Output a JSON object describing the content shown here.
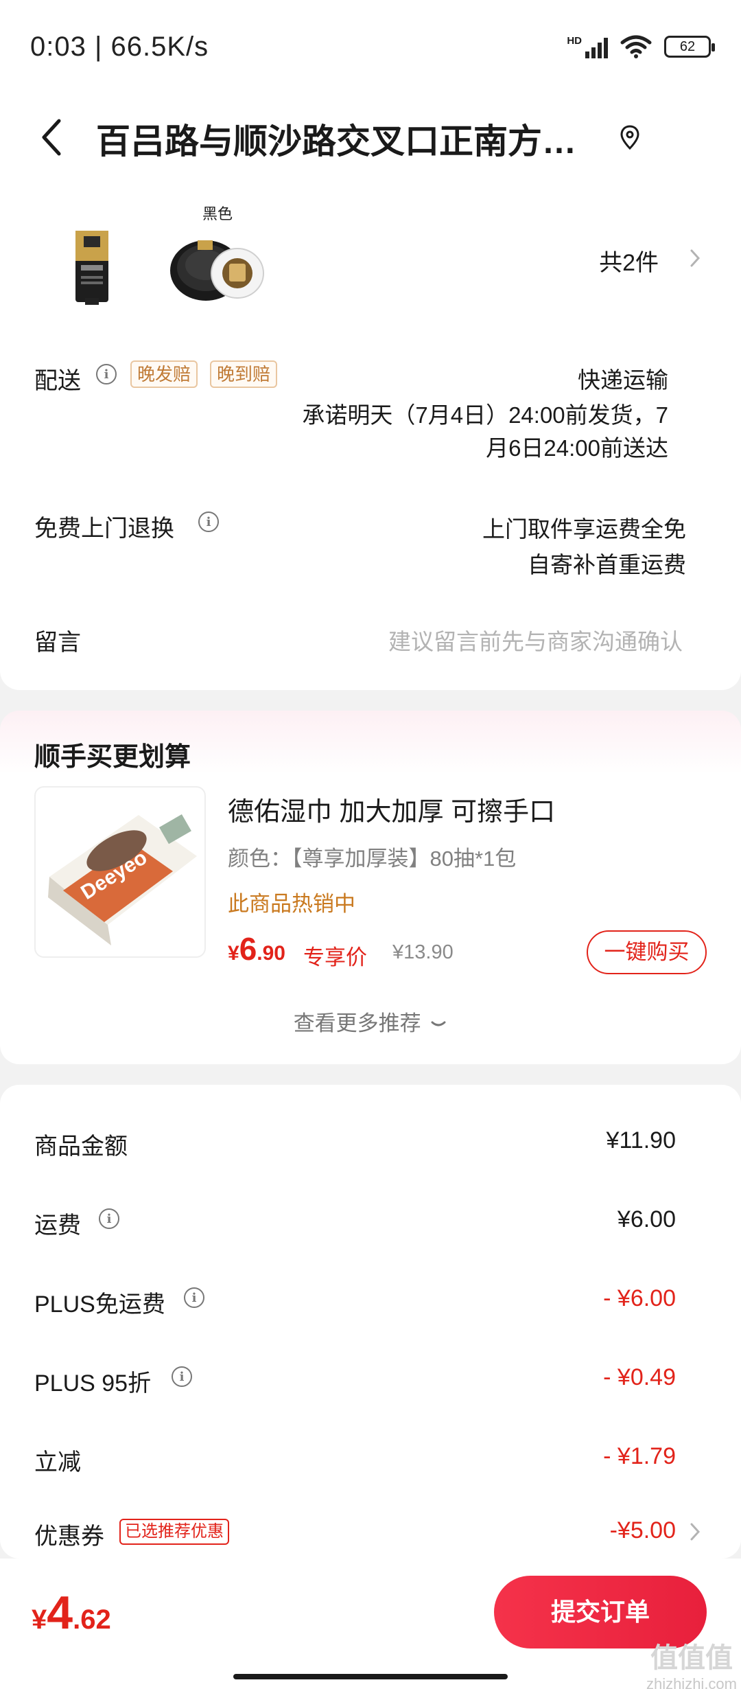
{
  "status_bar": {
    "time_speed": "0:03 | 66.5K/s",
    "network": "HD",
    "battery": "62"
  },
  "header": {
    "address": "百吕路与顺沙路交叉口正南方…"
  },
  "order": {
    "variant_label": "黑色",
    "item_count": "共2件",
    "delivery": {
      "label": "配送",
      "tag_late_ship": "晚发赔",
      "tag_late_arrive": "晚到赔",
      "method": "快递运输",
      "promise_line1": "承诺明天（7月4日）24:00前发货，7",
      "promise_line2": "月6日24:00前送达"
    },
    "return": {
      "label": "免费上门退换",
      "line1": "上门取件享运费全免",
      "line2": "自寄补首重运费"
    },
    "message": {
      "label": "留言",
      "placeholder": "建议留言前先与商家沟通确认"
    }
  },
  "recommend": {
    "title": "顺手买更划算",
    "product_name": "德佑湿巾 加大加厚 可擦手口",
    "spec": "颜色：【尊享加厚装】80抽*1包",
    "hot": "此商品热销中",
    "price_yen": "¥",
    "price_int": "6",
    "price_dec": ".90",
    "exclusive_label": "专享价",
    "original_price": "¥13.90",
    "buy_label": "一键购买",
    "more_label": "查看更多推荐"
  },
  "summary": {
    "goods_label": "商品金额",
    "goods_value": "¥11.90",
    "freight_label": "运费",
    "freight_value": "¥6.00",
    "plus_free_label": "PLUS免运费",
    "plus_free_value": "- ¥6.00",
    "plus_discount_label": "PLUS 95折",
    "plus_discount_value": "- ¥0.49",
    "instant_label": "立减",
    "instant_value": "- ¥1.79",
    "coupon_label": "优惠券",
    "coupon_tag": "已选推荐优惠",
    "coupon_value": "-¥5.00"
  },
  "bottom": {
    "total_yen": "¥",
    "total_int": "4",
    "total_dec": ".62",
    "submit_label": "提交订单"
  },
  "watermark": {
    "text": "zhizhizhi.com"
  },
  "colors": {
    "accent_red": "#e2231a",
    "tag_orange": "#c07b36",
    "hot_orange": "#c9791f"
  }
}
